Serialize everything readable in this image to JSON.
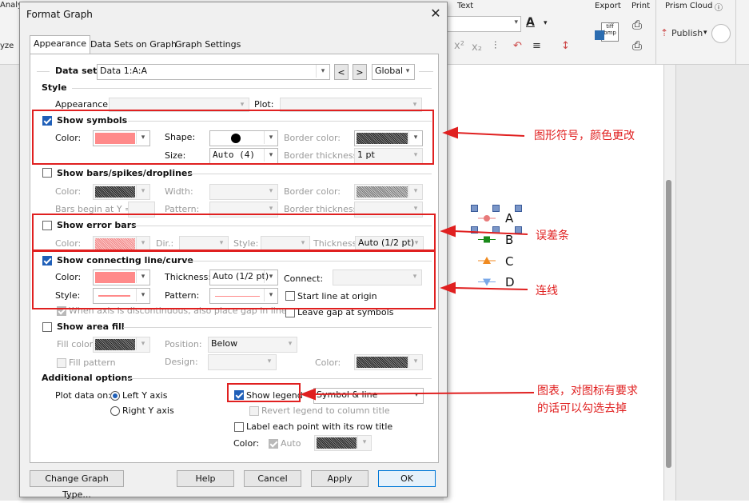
{
  "ribbon": {
    "analysis_label": "Analy",
    "analyze_label": "yze",
    "text_label": "Text",
    "export_label": "Export",
    "export_icon_text": "tiff bmp",
    "print_label": "Print",
    "prism_cloud_label": "Prism Cloud",
    "publish_label": "Publish"
  },
  "graph": {
    "legend": [
      {
        "label": "A",
        "color": "#e87a7a",
        "marker": "circle"
      },
      {
        "label": "B",
        "color": "#1a8a1a",
        "marker": "square"
      },
      {
        "label": "C",
        "color": "#f08a20",
        "marker": "triangle-up"
      },
      {
        "label": "D",
        "color": "#7aa8e8",
        "marker": "triangle-down"
      }
    ]
  },
  "dialog": {
    "title": "Format Graph",
    "tabs": [
      "Appearance",
      "Data Sets on Graph",
      "Graph Settings"
    ],
    "dataset": {
      "label": "Data set:",
      "value": "Data 1:A:A",
      "prev": "<",
      "next": ">",
      "scope": "Global"
    },
    "style": {
      "title": "Style",
      "appearance_label": "Appearance:",
      "plot_label": "Plot:"
    },
    "symbols": {
      "title": "Show symbols",
      "checked": true,
      "color_label": "Color:",
      "shape_label": "Shape:",
      "border_color_label": "Border color:",
      "size_label": "Size:",
      "size_value": "Auto (4)",
      "border_thickness_label": "Border thickness:",
      "border_thickness_value": "1 pt",
      "color": "#ff8a8a"
    },
    "bars": {
      "title": "Show bars/spikes/droplines",
      "checked": false,
      "color_label": "Color:",
      "width_label": "Width:",
      "border_color_label": "Border color:",
      "begin_label": "Bars begin at Y =",
      "pattern_label": "Pattern:",
      "border_thickness_label": "Border thickness:"
    },
    "error_bars": {
      "title": "Show error bars",
      "checked": false,
      "color_label": "Color:",
      "dir_label": "Dir.:",
      "style_label": "Style:",
      "thickness_label": "Thickness:",
      "thickness_value": "Auto (1/2 pt)"
    },
    "connecting_line": {
      "title": "Show connecting line/curve",
      "checked": true,
      "color_label": "Color:",
      "thickness_label": "Thickness:",
      "thickness_value": "Auto (1/2 pt)",
      "connect_label": "Connect:",
      "style_label": "Style:",
      "pattern_label": "Pattern:",
      "start_at_origin_label": "Start line at origin",
      "discontinuous_label": "When axis is discontinuous, also place gap in line",
      "leave_gap_label": "Leave gap at symbols"
    },
    "area_fill": {
      "title": "Show area fill",
      "checked": false,
      "fill_color_label": "Fill color:",
      "position_label": "Position:",
      "position_value": "Below",
      "fill_pattern_label": "Fill pattern",
      "design_label": "Design:",
      "color_label": "Color:"
    },
    "additional": {
      "title": "Additional options",
      "plot_on_label": "Plot data on:",
      "left_axis_label": "Left Y axis",
      "right_axis_label": "Right  Y axis",
      "show_legend_label": "Show legend",
      "legend_style_value": "Symbol & line",
      "revert_legend_label": "Revert legend to column title",
      "label_each_point_label": "Label each point with its row title",
      "color_label": "Color:",
      "auto_label": "Auto"
    },
    "buttons": {
      "change_graph_type": "Change Graph Type...",
      "help": "Help",
      "cancel": "Cancel",
      "apply": "Apply",
      "ok": "OK"
    }
  },
  "annotations": {
    "symbols_note": "图形符号，颜色更改",
    "error_bars_note": "误差条",
    "line_note": "连线",
    "legend_note_line1": "图表，对图标有要求",
    "legend_note_line2": "的话可以勾选去掉",
    "color": "#e02020"
  }
}
